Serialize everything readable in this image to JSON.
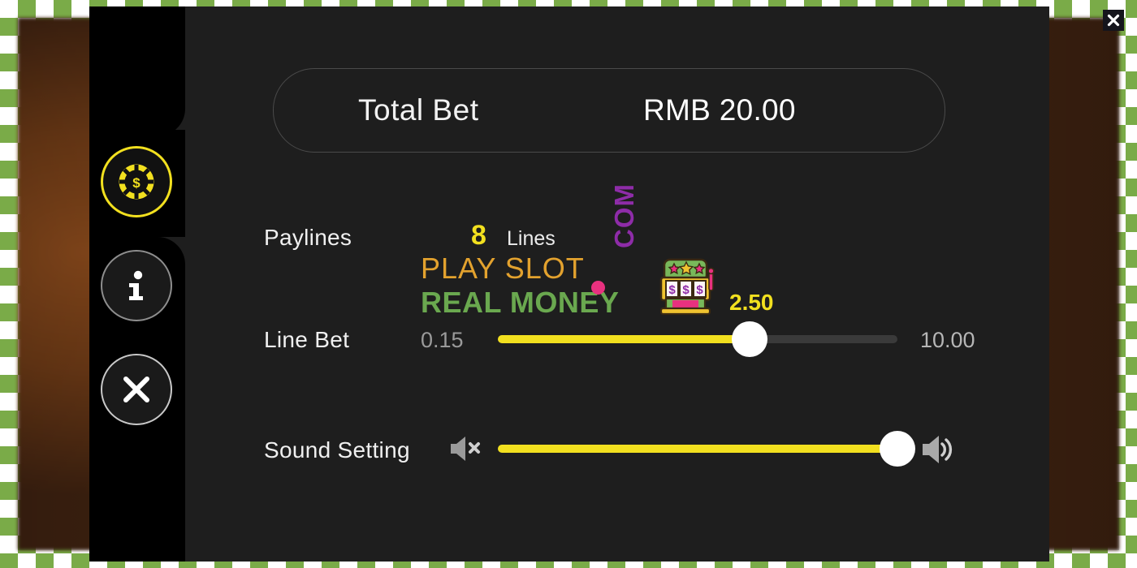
{
  "window": {
    "close_label": "✕",
    "close_icon": "close-icon"
  },
  "background": {
    "checkerboard_color": "#7aab48",
    "photo_colors": [
      "#8a4a1c",
      "#6d3a16",
      "#3d2110"
    ]
  },
  "sidebar": {
    "items": [
      {
        "id": "bet-settings",
        "icon": "casino-chip-icon",
        "active": true,
        "color": "#f2e01f"
      },
      {
        "id": "info",
        "icon": "info-icon",
        "active": false,
        "label": "i",
        "color": "#ffffff"
      },
      {
        "id": "close",
        "icon": "close-icon",
        "active": false,
        "color": "#ffffff"
      }
    ]
  },
  "panel": {
    "background": "#1e1e1e",
    "total_bet": {
      "label": "Total Bet",
      "value": "RMB 20.00",
      "currency": "RMB",
      "amount": "20.00"
    },
    "paylines": {
      "label": "Paylines",
      "count": "8",
      "unit": "Lines"
    },
    "line_bet": {
      "label": "Line Bet",
      "min": "0.15",
      "max": "10.00",
      "value": "2.50",
      "fill_percent": 63,
      "accent": "#f2e01f"
    },
    "sound_setting": {
      "label": "Sound Setting",
      "mute_icon": "volume-mute-icon",
      "up_icon": "volume-up-icon",
      "value": 100,
      "fill_percent": 100,
      "accent": "#f2e01f"
    }
  },
  "watermark": {
    "line1": "PLAY SLOT",
    "line2": "REAL MONEY",
    "tld": "COM",
    "dot_color": "#e8317f",
    "line1_color": "#e3a22e",
    "line2_color": "#6aa84f",
    "tld_color": "#8e2ca8",
    "slot_icon": "slot-machine-icon"
  }
}
